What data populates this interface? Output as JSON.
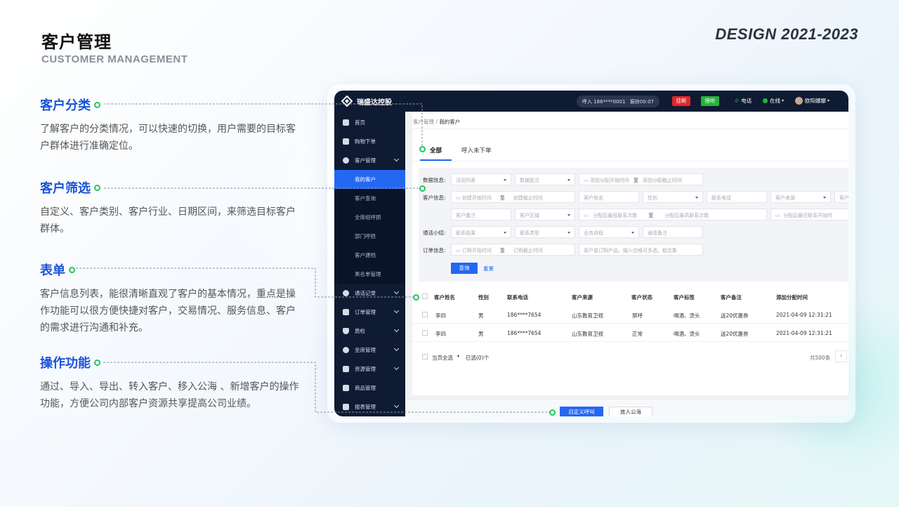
{
  "header": {
    "title": "客户管理",
    "subtitle": "CUSTOMER MANAGEMENT",
    "design_tag": "DESIGN 2021-2023"
  },
  "features": [
    {
      "title": "客户分类",
      "desc": "了解客户的分类情况，可以快速的切换，用户需要的目标客户群体进行准确定位。"
    },
    {
      "title": "客户筛选",
      "desc": "自定义、客户类别、客户行业、日期区间，来筛选目标客户群体。"
    },
    {
      "title": "表单",
      "desc": "客户信息列表，能很清晰直观了客户的基本情况，重点是操作功能可以很方便快捷对客户，交易情况、服务信息、客户的需求进行沟通和补充。"
    },
    {
      "title": "操作功能",
      "desc": "通过、导入、导出、转入客户、移入公海 、新增客户的操作功能，方便公司内部客户资源共享提高公司业绩。"
    }
  ],
  "app": {
    "brand": "瑞盛达控股",
    "call_info": "呼入 186****0001",
    "call_duration": "振铃00:07",
    "hangup": "挂断",
    "answer": "接听",
    "phone": "电话",
    "status": "在线",
    "user": "欧阳娜娜",
    "colors": {
      "topbar": "#0f1b33",
      "accent": "#2468f2",
      "hangup": "#e5252a",
      "answer": "#23b33a",
      "annotation": "#22c55e"
    }
  },
  "sidebar": {
    "items": [
      {
        "label": "首页",
        "icon": "home-icon"
      },
      {
        "label": "购物下单",
        "icon": "cart-icon"
      },
      {
        "label": "客户管理",
        "icon": "user-icon"
      }
    ],
    "sub_items": [
      "我的客户",
      "客户查询",
      "全席组呼损",
      "部门呼损",
      "客户建档",
      "黑名单管理"
    ],
    "more_items": [
      {
        "label": "通话记录",
        "icon": "phone-icon"
      },
      {
        "label": "订单管理",
        "icon": "order-icon"
      },
      {
        "label": "质检",
        "icon": "shield-icon"
      },
      {
        "label": "坐席管理",
        "icon": "headset-icon"
      },
      {
        "label": "资源管理",
        "icon": "list-icon"
      },
      {
        "label": "商品管理",
        "icon": "grid-icon"
      },
      {
        "label": "报表管理",
        "icon": "chart-icon"
      }
    ]
  },
  "breadcrumb": {
    "parent": "客户管理 /",
    "current": "我的客户"
  },
  "tabs": [
    "全部",
    "呼入未下单"
  ],
  "filters": {
    "labels": [
      "数据信息:",
      "客户信息:",
      "通话小结:",
      "订单信息:"
    ],
    "row1": [
      "活动列表",
      "数据批次",
      "添加分配开始时间",
      "至",
      "添加分配截止时间"
    ],
    "row2": [
      "创建开始时间",
      "至",
      "创建截止时间",
      "客户姓名",
      "性别",
      "联系电话",
      "客户来源",
      "客户"
    ],
    "row3": [
      "客户备注",
      "客户区域",
      "分配后最低联系次数",
      "至",
      "分配后最高联系次数",
      "分配后最近联系开始时"
    ],
    "row4": [
      "联系结果",
      "联系类型",
      "业务进程",
      "通话备注"
    ],
    "row5": [
      "订购开始时间",
      "至",
      "订购截止时间",
      "客户曾订购产品，输入空格可多选，取交集"
    ],
    "query": "查询",
    "reset": "重置"
  },
  "table": {
    "headers": [
      "客户姓名",
      "性别",
      "联系电话",
      "客户来源",
      "客户状态",
      "客户标签",
      "客户备注",
      "添加分配时间"
    ],
    "rows": [
      [
        "李四",
        "男",
        "186****7654",
        "山东教育卫视",
        "禁呼",
        "喝酒、烫头",
        "送20优惠券",
        "2021-04-09 12:31:21"
      ],
      [
        "李四",
        "男",
        "186****7654",
        "山东教育卫视",
        "正常",
        "喝酒、烫头",
        "送20优惠券",
        "2021-04-09 12:31:21"
      ]
    ],
    "footer": {
      "select_page": "当页全选",
      "selected": "已选(0)个",
      "total": "共500条"
    }
  },
  "actions": {
    "custom_call": "自定义呼叫",
    "to_pool": "放入公海"
  }
}
